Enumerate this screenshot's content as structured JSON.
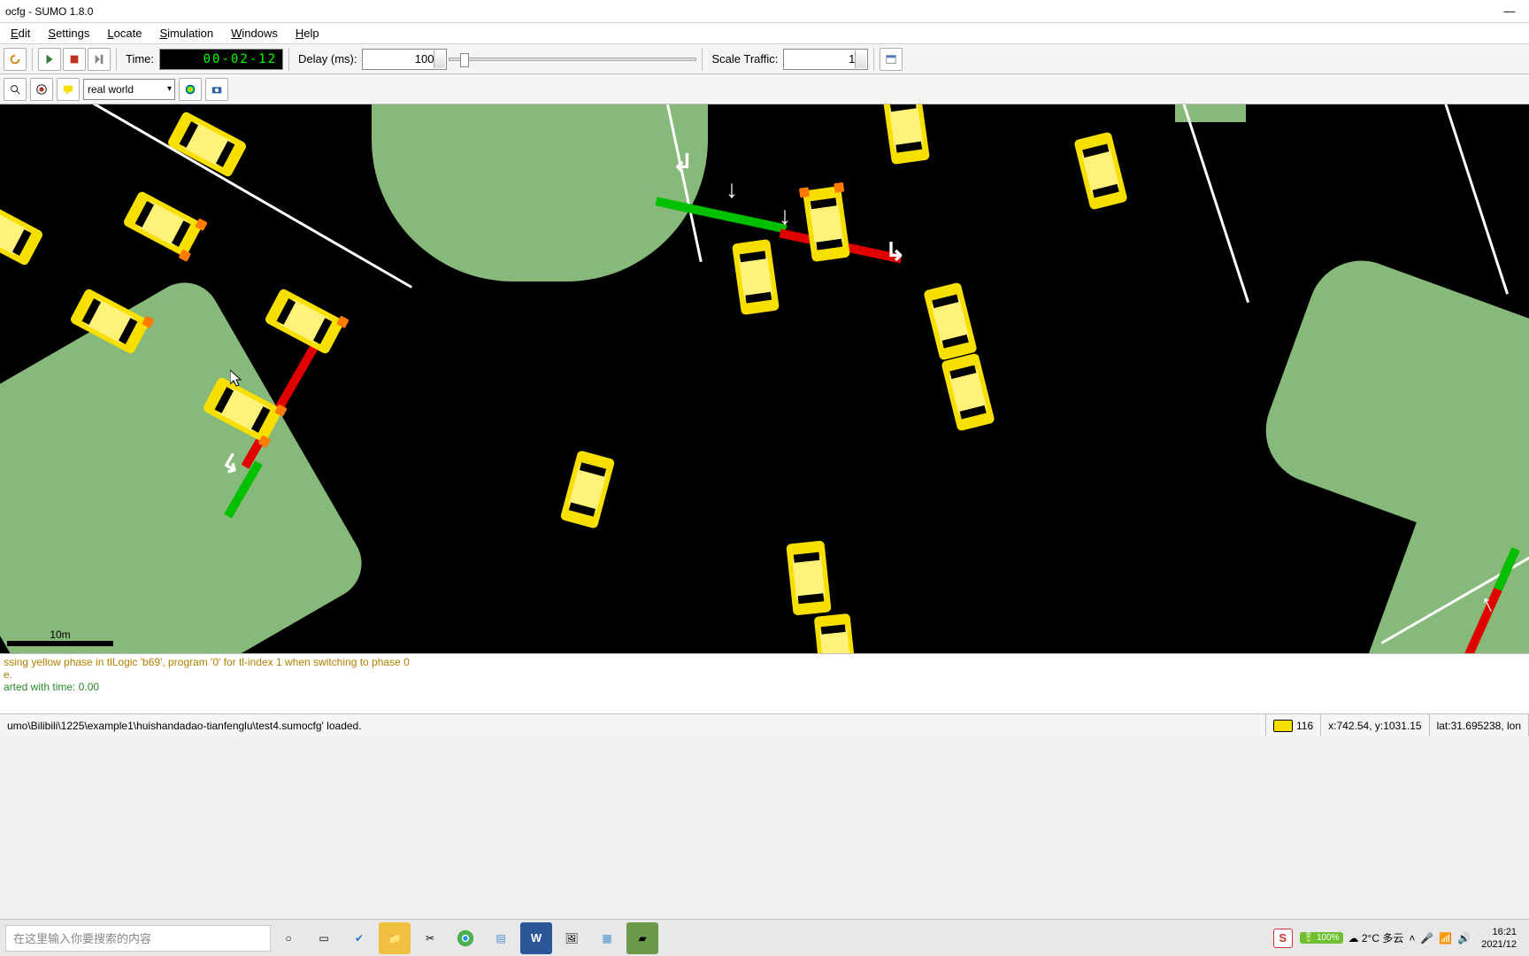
{
  "window": {
    "title": "ocfg - SUMO 1.8.0"
  },
  "menu": {
    "edit": "Edit",
    "settings": "Settings",
    "locate": "Locate",
    "simulation": "Simulation",
    "windows": "Windows",
    "help": "Help"
  },
  "toolbar": {
    "time_label": "Time:",
    "time_value": "00-02-12",
    "delay_label": "Delay (ms):",
    "delay_value": "100",
    "scale_label": "Scale Traffic:",
    "scale_value": "1"
  },
  "toolbar2": {
    "scheme": "real world"
  },
  "viewport": {
    "scale_text": "10m"
  },
  "log": {
    "l1": "ssing yellow phase in tlLogic 'b69', program '0' for tl-index 1 when switching to phase 0",
    "l2": "e.",
    "l3": "arted with time: 0.00"
  },
  "status": {
    "path": "umo\\Bilibili\\1225\\example1\\huishandadao-tianfenglu\\test4.sumocfg' loaded.",
    "vehicle_count": "116",
    "xy": "x:742.54, y:1031.15",
    "latlon": "lat:31.695238, lon"
  },
  "taskbar": {
    "search_placeholder": "在这里输入你要搜索的内容",
    "weather": "2°C 多云",
    "battery": "100%",
    "time": "16:21",
    "date": "2021/12"
  }
}
